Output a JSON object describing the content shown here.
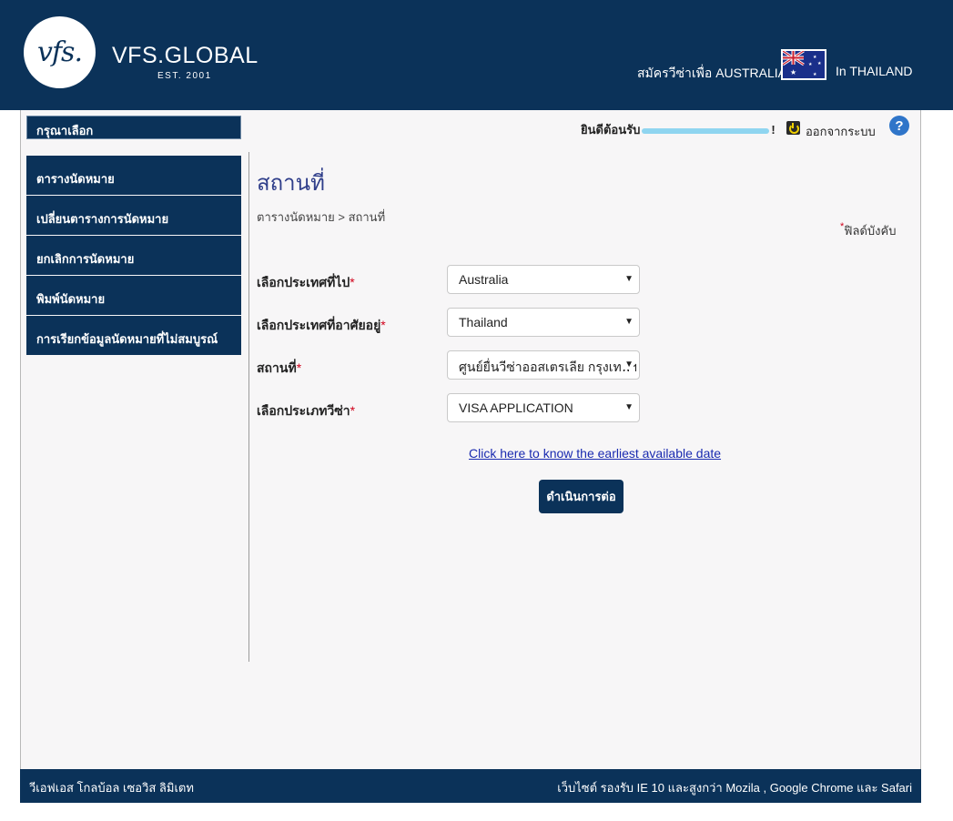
{
  "header": {
    "brand_logo_text": "vfs.",
    "brand_name": "VFS.GLOBAL",
    "brand_est": "EST. 2001",
    "apply_text": "สมัครวีซ่าเพื่อ AUSTRALIA",
    "flag_icon": "australia-flag-icon",
    "location_text": "In THAILAND"
  },
  "topbar": {
    "choose_label": "กรุณาเลือก",
    "welcome_prefix": "ยินดีต้อนรับ",
    "welcome_suffix": "!",
    "logout_label": "ออกจากระบบ",
    "help_label": "?"
  },
  "sidebar": {
    "items": [
      {
        "label": "ตารางนัดหมาย"
      },
      {
        "label": "เปลี่ยนตารางการนัดหมาย"
      },
      {
        "label": "ยกเลิกการนัดหมาย"
      },
      {
        "label": "พิมพ์นัดหมาย"
      },
      {
        "label": "การเรียกข้อมูลนัดหมายที่ไม่สมบูรณ์"
      }
    ]
  },
  "main": {
    "title": "สถานที่",
    "breadcrumb": "ตารางนัดหมาย  >  สถานที่",
    "required_star": "*",
    "required_note": "ฟิลด์บังคับ",
    "fields": [
      {
        "label": "เลือกประเทศที่ไป",
        "star": "*",
        "value": "Australia"
      },
      {
        "label": "เลือกประเทศที่อาศัยอยู่",
        "star": "*",
        "value": "Thailand"
      },
      {
        "label": "สถานที่",
        "star": "*",
        "value": "ศูนย์ยื่นวีซ่าออสเตรเลีย กรุงเทพฯ"
      },
      {
        "label": "เลือกประเภทวีซ่า",
        "star": "*",
        "value": "VISA APPLICATION"
      }
    ],
    "earliest_link": "Click here to know the earliest available date",
    "continue_button": "ดำเนินการต่อ"
  },
  "footer": {
    "left": "วีเอฟเอส โกลบ้อล เซอวิส ลิมิเตท",
    "right": "เว็บไซต์ รองรับ IE 10 และสูงกว่า Mozila , Google Chrome และ Safari"
  }
}
